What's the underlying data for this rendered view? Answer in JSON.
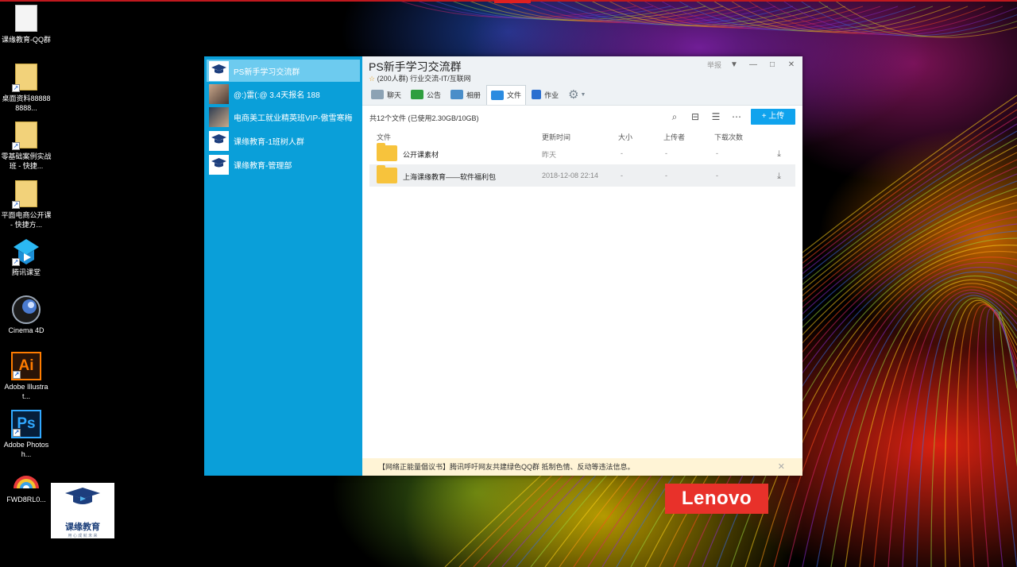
{
  "desktop": {
    "icons": [
      {
        "label": "课缘教育-QQ群",
        "icon": "document-icon"
      },
      {
        "label": "桌面资料888888888...",
        "icon": "folder-shortcut-icon"
      },
      {
        "label": "零基础案例实战班 - 快捷...",
        "icon": "folder-shortcut-icon"
      },
      {
        "label": "平面电商公开课 - 快捷方...",
        "icon": "folder-shortcut-icon"
      },
      {
        "label": "腾讯课堂",
        "icon": "tencent-classroom-icon"
      },
      {
        "label": "Cinema 4D",
        "icon": "cinema4d-icon"
      },
      {
        "label": "Adobe Illustrat...",
        "icon": "illustrator-icon",
        "glyph": "Ai"
      },
      {
        "label": "Adobe Photosh...",
        "icon": "photoshop-icon",
        "glyph": "Ps"
      },
      {
        "label": "FWD8RL0...",
        "icon": "fan-image-icon"
      }
    ],
    "logo_tile": {
      "title": "课缘教育",
      "subtitle": "用 心 成 就 未 来"
    },
    "brand_badge": "Lenovo"
  },
  "sidebar": {
    "items": [
      {
        "label": "PS新手学习交流群",
        "active": true
      },
      {
        "label": "@:)雷(:@ 3.4天报名 188",
        "active": false
      },
      {
        "label": "电商美工就业精英班VIP-傲雪寒梅",
        "active": false
      },
      {
        "label": "课缘教育-1班树人群",
        "active": false
      },
      {
        "label": "课缘教育-管理部",
        "active": false
      }
    ]
  },
  "header": {
    "title": "PS新手学习交流群",
    "subtitle": "(200人群) 行业交流-IT/互联网",
    "report": "举报",
    "controls": [
      "▼",
      "—",
      "□",
      "✕"
    ]
  },
  "tabs": [
    {
      "label": "聊天",
      "color": "#8ca2b4",
      "active": false
    },
    {
      "label": "公告",
      "color": "#2f9e3f",
      "active": false
    },
    {
      "label": "相册",
      "color": "#4a8ec9",
      "active": false
    },
    {
      "label": "文件",
      "color": "#2b8be0",
      "active": true
    },
    {
      "label": "作业",
      "color": "#2b6fd0",
      "active": false
    }
  ],
  "files": {
    "summary": "共12个文件 (已使用2.30GB/10GB)",
    "upload_label": "+ 上传",
    "columns": [
      "文件",
      "更新时间",
      "大小",
      "上传者",
      "下载次数"
    ],
    "rows": [
      {
        "name": "公开课素材",
        "updated": "昨天",
        "size": "-",
        "uploader": "-",
        "downloads": "-"
      },
      {
        "name": "上海课缘教育——软件福利包",
        "updated": "2018-12-08 22:14",
        "size": "-",
        "uploader": "-",
        "downloads": "-"
      }
    ]
  },
  "notice": {
    "text": "【网络正能量倡议书】腾讯呼吁网友共建绿色QQ群 抵制色情、反动等违法信息。",
    "close": "✕"
  },
  "colors": {
    "sidebar_bg": "#0a9fd9",
    "sidebar_active": "#6dcbef",
    "upload_button": "#10a3ed",
    "lenovo_red": "#e8312a"
  }
}
